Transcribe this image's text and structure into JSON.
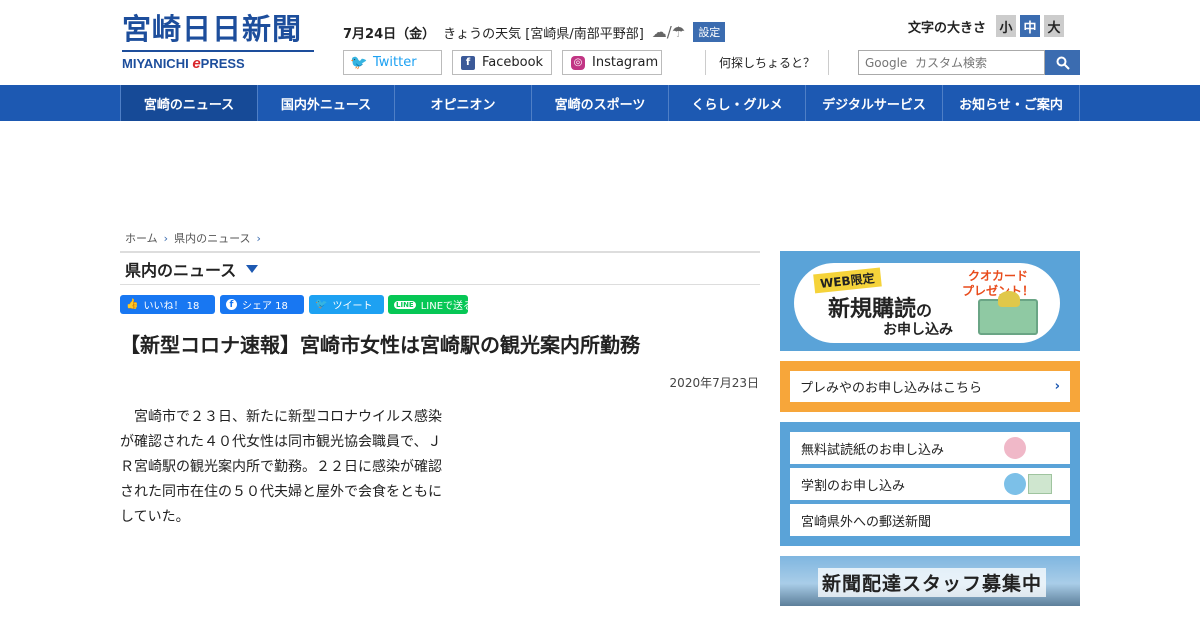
{
  "header": {
    "logo_jp": "宮崎日日新聞",
    "logo_en_prefix": "MIYANICHI ",
    "logo_en_e": "e",
    "logo_en_suffix": "PRESS",
    "date": "7月24日（金）",
    "weather_label": "きょうの天気 [宮崎県/南部平野部]",
    "weather_icons": "☁/☂",
    "setting_label": "設定",
    "social": {
      "twitter": "Twitter",
      "facebook": "Facebook",
      "instagram": "Instagram"
    },
    "search_hint": "何探しちょると？",
    "font_size_label": "文字の大きさ",
    "font_sizes": [
      "小",
      "中",
      "大"
    ],
    "search_placeholder": "Google  カスタム検索"
  },
  "nav": [
    "宮崎のニュース",
    "国内外ニュース",
    "オピニオン",
    "宮崎のスポーツ",
    "くらし・グルメ",
    "デジタルサービス",
    "お知らせ・ご案内"
  ],
  "breadcrumb": [
    "ホーム",
    "県内のニュース"
  ],
  "section_title": "県内のニュース",
  "share": {
    "like": "いいね！ 18",
    "fb": "シェア 18",
    "tw": "ツイート",
    "line": "LINEで送る"
  },
  "article": {
    "title": "【新型コロナ速報】宮崎市女性は宮崎駅の観光案内所勤務",
    "date": "2020年7月23日",
    "body": "　宮崎市で２３日、新たに新型コロナウイルス感染が確認された４０代女性は同市観光協会職員で、ＪＲ宮崎駅の観光案内所で勤務。２２日に感染が確認された同市在住の５０代夫婦と屋外で会食をともにしていた。"
  },
  "sidebar": {
    "subscribe": {
      "tag": "WEB限定",
      "main": "新規購読",
      "no": "の",
      "sub": "お申し込み",
      "present": "クオカード\nプレゼント！"
    },
    "premi": "プレみやのお申し込みはこちら",
    "list": [
      "無料試読紙のお申し込み",
      "学割のお申し込み",
      "宮崎県外への郵送新聞"
    ],
    "staff": "新聞配達スタッフ募集中"
  },
  "colors": {
    "nav_blue": "#1d59b2",
    "logo_blue": "#1d4e9c",
    "sidebar_blue": "#5aa3d8",
    "orange": "#f7a63a"
  }
}
